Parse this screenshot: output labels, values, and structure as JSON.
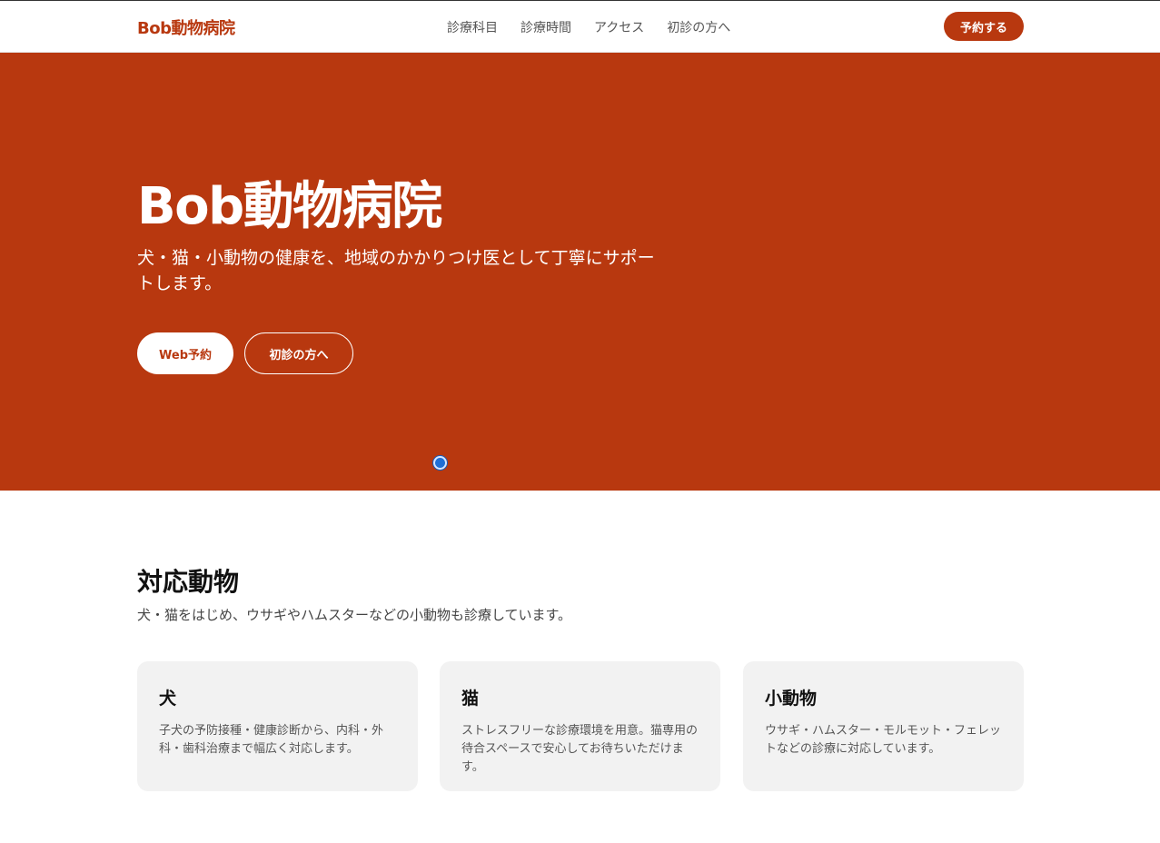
{
  "header": {
    "logo": "Bob動物病院",
    "nav": [
      "診療科目",
      "診療時間",
      "アクセス",
      "初診の方へ"
    ],
    "cta_label": "予約する"
  },
  "hero": {
    "title": "Bob動物病院",
    "subtitle": "犬・猫・小動物の健康を、地域のかかりつけ医として丁寧にサポートします。",
    "primary_button": "Web予約",
    "secondary_button": "初診の方へ"
  },
  "animals": {
    "title": "対応動物",
    "description": "犬・猫をはじめ、ウサギやハムスターなどの小動物も診療しています。",
    "cards": [
      {
        "title": "犬",
        "text": "子犬の予防接種・健康診断から、内科・外科・歯科治療まで幅広く対応します。"
      },
      {
        "title": "猫",
        "text": "ストレスフリーな診療環境を用意。猫専用の待合スペースで安心してお待ちいただけます。"
      },
      {
        "title": "小動物",
        "text": "ウサギ・ハムスター・モルモット・フェレットなどの診療に対応しています。"
      }
    ]
  },
  "colors": {
    "brand": "#b8380f",
    "card_background": "#f2f2f2",
    "cursor_dot": "#1f6fd6"
  }
}
